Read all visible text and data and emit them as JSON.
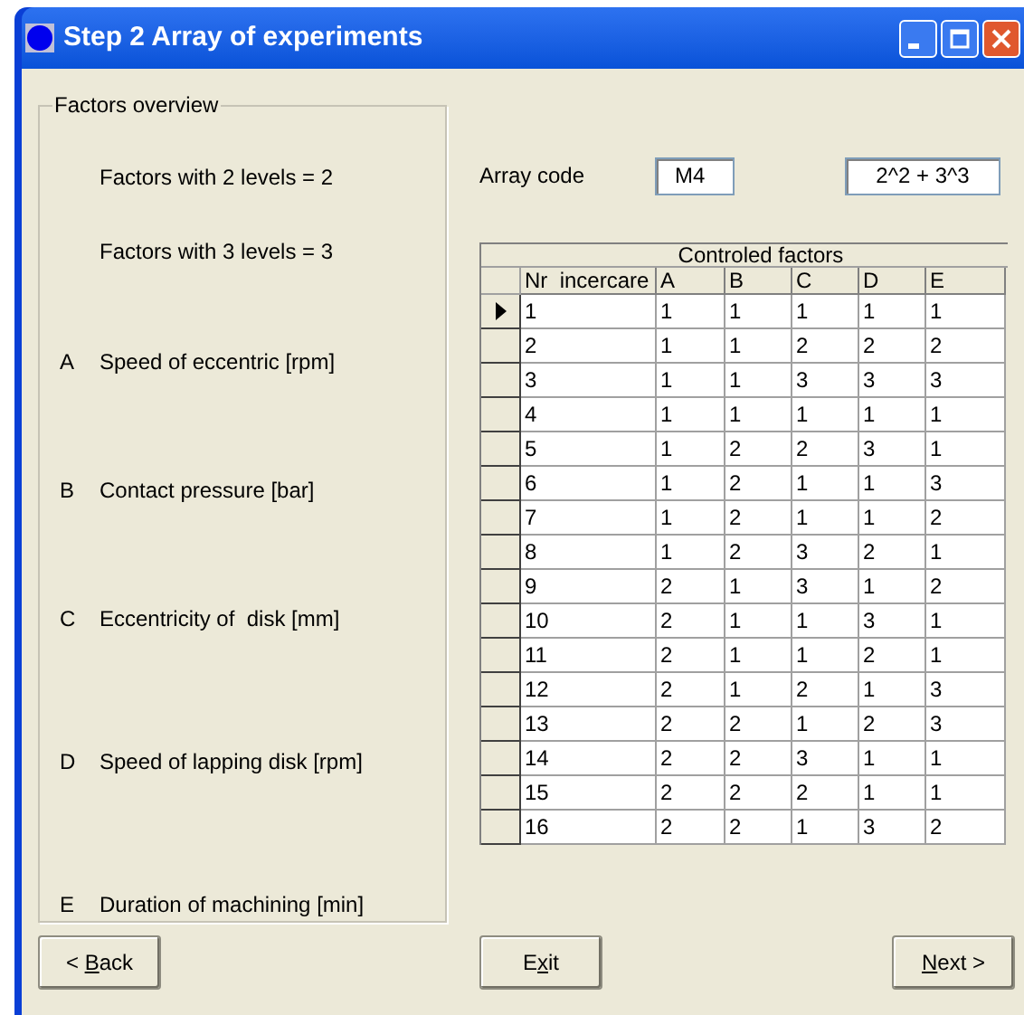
{
  "window": {
    "title": "Step 2 Array of experiments"
  },
  "factors_overview": {
    "title": "Factors overview",
    "summary": [
      "Factors with 2 levels = 2",
      "Factors with 3 levels = 3"
    ],
    "factors": [
      {
        "letter": "A",
        "name": "Speed of eccentric [rpm]"
      },
      {
        "letter": "B",
        "name": "Contact pressure [bar]"
      },
      {
        "letter": "C",
        "name": "Eccentricity of  disk [mm]"
      },
      {
        "letter": "D",
        "name": "Speed of lapping disk [rpm]"
      },
      {
        "letter": "E",
        "name": "Duration of machining [min]"
      }
    ]
  },
  "array_code": {
    "label": "Array code",
    "value": "M4",
    "formula": "2^2 + 3^3"
  },
  "table": {
    "caption": "Controled factors",
    "columns": [
      "Nr  incercare",
      "A",
      "B",
      "C",
      "D",
      "E"
    ],
    "rows": [
      {
        "selected": true,
        "cells": [
          "1",
          "1",
          "1",
          "1",
          "1",
          "1"
        ]
      },
      {
        "selected": false,
        "cells": [
          "2",
          "1",
          "1",
          "2",
          "2",
          "2"
        ]
      },
      {
        "selected": false,
        "cells": [
          "3",
          "1",
          "1",
          "3",
          "3",
          "3"
        ]
      },
      {
        "selected": false,
        "cells": [
          "4",
          "1",
          "1",
          "1",
          "1",
          "1"
        ]
      },
      {
        "selected": false,
        "cells": [
          "5",
          "1",
          "2",
          "2",
          "3",
          "1"
        ]
      },
      {
        "selected": false,
        "cells": [
          "6",
          "1",
          "2",
          "1",
          "1",
          "3"
        ]
      },
      {
        "selected": false,
        "cells": [
          "7",
          "1",
          "2",
          "1",
          "1",
          "2"
        ]
      },
      {
        "selected": false,
        "cells": [
          "8",
          "1",
          "2",
          "3",
          "2",
          "1"
        ]
      },
      {
        "selected": false,
        "cells": [
          "9",
          "2",
          "1",
          "3",
          "1",
          "2"
        ]
      },
      {
        "selected": false,
        "cells": [
          "10",
          "2",
          "1",
          "1",
          "3",
          "1"
        ]
      },
      {
        "selected": false,
        "cells": [
          "11",
          "2",
          "1",
          "1",
          "2",
          "1"
        ]
      },
      {
        "selected": false,
        "cells": [
          "12",
          "2",
          "1",
          "2",
          "1",
          "3"
        ]
      },
      {
        "selected": false,
        "cells": [
          "13",
          "2",
          "2",
          "1",
          "2",
          "3"
        ]
      },
      {
        "selected": false,
        "cells": [
          "14",
          "2",
          "2",
          "3",
          "1",
          "1"
        ]
      },
      {
        "selected": false,
        "cells": [
          "15",
          "2",
          "2",
          "2",
          "1",
          "1"
        ]
      },
      {
        "selected": false,
        "cells": [
          "16",
          "2",
          "2",
          "1",
          "3",
          "2"
        ]
      }
    ]
  },
  "buttons": [
    {
      "before": "< ",
      "key": "B",
      "after": "ack"
    },
    {
      "before": "E",
      "key": "x",
      "after": "it"
    },
    {
      "key": "N",
      "after": "ext >"
    }
  ]
}
